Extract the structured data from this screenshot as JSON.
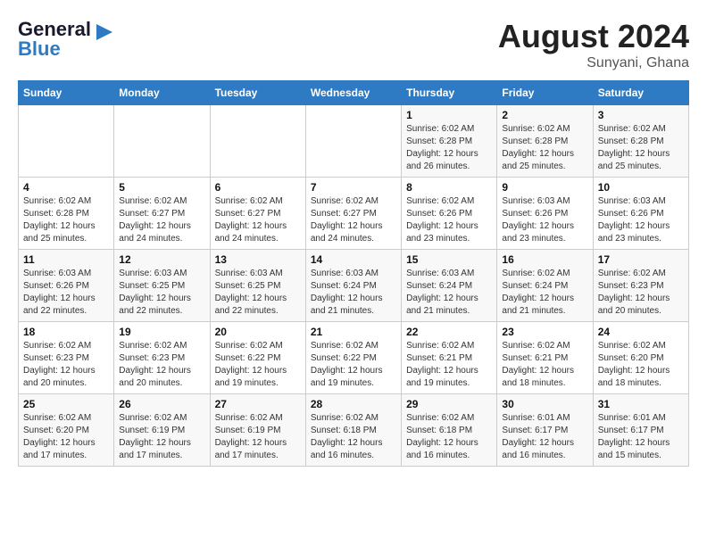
{
  "header": {
    "logo_line1": "General",
    "logo_line2": "Blue",
    "month": "August 2024",
    "location": "Sunyani, Ghana"
  },
  "days_of_week": [
    "Sunday",
    "Monday",
    "Tuesday",
    "Wednesday",
    "Thursday",
    "Friday",
    "Saturday"
  ],
  "weeks": [
    [
      {
        "day": "",
        "info": ""
      },
      {
        "day": "",
        "info": ""
      },
      {
        "day": "",
        "info": ""
      },
      {
        "day": "",
        "info": ""
      },
      {
        "day": "1",
        "info": "Sunrise: 6:02 AM\nSunset: 6:28 PM\nDaylight: 12 hours\nand 26 minutes."
      },
      {
        "day": "2",
        "info": "Sunrise: 6:02 AM\nSunset: 6:28 PM\nDaylight: 12 hours\nand 25 minutes."
      },
      {
        "day": "3",
        "info": "Sunrise: 6:02 AM\nSunset: 6:28 PM\nDaylight: 12 hours\nand 25 minutes."
      }
    ],
    [
      {
        "day": "4",
        "info": "Sunrise: 6:02 AM\nSunset: 6:28 PM\nDaylight: 12 hours\nand 25 minutes."
      },
      {
        "day": "5",
        "info": "Sunrise: 6:02 AM\nSunset: 6:27 PM\nDaylight: 12 hours\nand 24 minutes."
      },
      {
        "day": "6",
        "info": "Sunrise: 6:02 AM\nSunset: 6:27 PM\nDaylight: 12 hours\nand 24 minutes."
      },
      {
        "day": "7",
        "info": "Sunrise: 6:02 AM\nSunset: 6:27 PM\nDaylight: 12 hours\nand 24 minutes."
      },
      {
        "day": "8",
        "info": "Sunrise: 6:02 AM\nSunset: 6:26 PM\nDaylight: 12 hours\nand 23 minutes."
      },
      {
        "day": "9",
        "info": "Sunrise: 6:03 AM\nSunset: 6:26 PM\nDaylight: 12 hours\nand 23 minutes."
      },
      {
        "day": "10",
        "info": "Sunrise: 6:03 AM\nSunset: 6:26 PM\nDaylight: 12 hours\nand 23 minutes."
      }
    ],
    [
      {
        "day": "11",
        "info": "Sunrise: 6:03 AM\nSunset: 6:26 PM\nDaylight: 12 hours\nand 22 minutes."
      },
      {
        "day": "12",
        "info": "Sunrise: 6:03 AM\nSunset: 6:25 PM\nDaylight: 12 hours\nand 22 minutes."
      },
      {
        "day": "13",
        "info": "Sunrise: 6:03 AM\nSunset: 6:25 PM\nDaylight: 12 hours\nand 22 minutes."
      },
      {
        "day": "14",
        "info": "Sunrise: 6:03 AM\nSunset: 6:24 PM\nDaylight: 12 hours\nand 21 minutes."
      },
      {
        "day": "15",
        "info": "Sunrise: 6:03 AM\nSunset: 6:24 PM\nDaylight: 12 hours\nand 21 minutes."
      },
      {
        "day": "16",
        "info": "Sunrise: 6:02 AM\nSunset: 6:24 PM\nDaylight: 12 hours\nand 21 minutes."
      },
      {
        "day": "17",
        "info": "Sunrise: 6:02 AM\nSunset: 6:23 PM\nDaylight: 12 hours\nand 20 minutes."
      }
    ],
    [
      {
        "day": "18",
        "info": "Sunrise: 6:02 AM\nSunset: 6:23 PM\nDaylight: 12 hours\nand 20 minutes."
      },
      {
        "day": "19",
        "info": "Sunrise: 6:02 AM\nSunset: 6:23 PM\nDaylight: 12 hours\nand 20 minutes."
      },
      {
        "day": "20",
        "info": "Sunrise: 6:02 AM\nSunset: 6:22 PM\nDaylight: 12 hours\nand 19 minutes."
      },
      {
        "day": "21",
        "info": "Sunrise: 6:02 AM\nSunset: 6:22 PM\nDaylight: 12 hours\nand 19 minutes."
      },
      {
        "day": "22",
        "info": "Sunrise: 6:02 AM\nSunset: 6:21 PM\nDaylight: 12 hours\nand 19 minutes."
      },
      {
        "day": "23",
        "info": "Sunrise: 6:02 AM\nSunset: 6:21 PM\nDaylight: 12 hours\nand 18 minutes."
      },
      {
        "day": "24",
        "info": "Sunrise: 6:02 AM\nSunset: 6:20 PM\nDaylight: 12 hours\nand 18 minutes."
      }
    ],
    [
      {
        "day": "25",
        "info": "Sunrise: 6:02 AM\nSunset: 6:20 PM\nDaylight: 12 hours\nand 17 minutes."
      },
      {
        "day": "26",
        "info": "Sunrise: 6:02 AM\nSunset: 6:19 PM\nDaylight: 12 hours\nand 17 minutes."
      },
      {
        "day": "27",
        "info": "Sunrise: 6:02 AM\nSunset: 6:19 PM\nDaylight: 12 hours\nand 17 minutes."
      },
      {
        "day": "28",
        "info": "Sunrise: 6:02 AM\nSunset: 6:18 PM\nDaylight: 12 hours\nand 16 minutes."
      },
      {
        "day": "29",
        "info": "Sunrise: 6:02 AM\nSunset: 6:18 PM\nDaylight: 12 hours\nand 16 minutes."
      },
      {
        "day": "30",
        "info": "Sunrise: 6:01 AM\nSunset: 6:17 PM\nDaylight: 12 hours\nand 16 minutes."
      },
      {
        "day": "31",
        "info": "Sunrise: 6:01 AM\nSunset: 6:17 PM\nDaylight: 12 hours\nand 15 minutes."
      }
    ]
  ]
}
